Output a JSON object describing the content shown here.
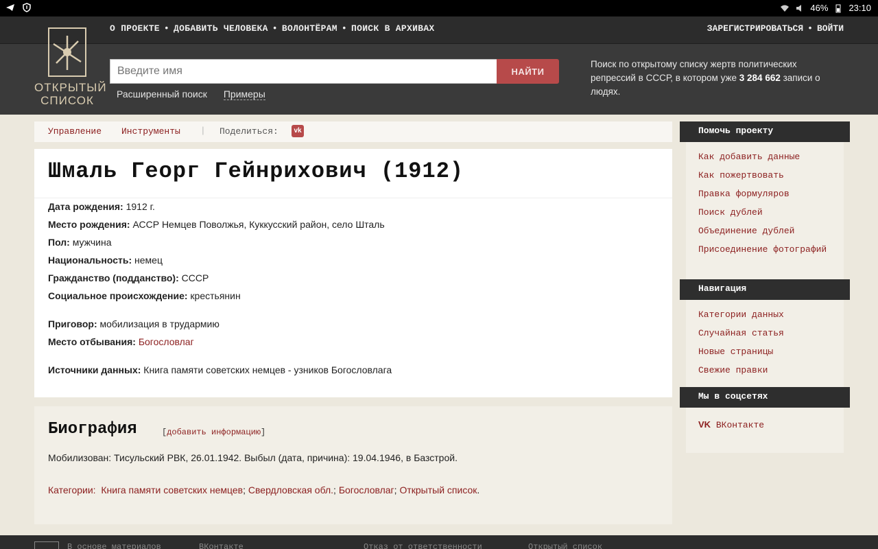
{
  "status_bar": {
    "battery": "46%",
    "time": "23:10",
    "icons": [
      "telegram-icon",
      "shield-icon",
      "wifi-icon",
      "mute-icon",
      "battery-icon"
    ]
  },
  "nav": {
    "left": [
      "О ПРОЕКТЕ",
      "ДОБАВИТЬ ЧЕЛОВЕКА",
      "ВОЛОНТЁРАМ",
      "ПОИСК В АРХИВАХ"
    ],
    "right": [
      "ЗАРЕГИСТРИРОВАТЬСЯ",
      "ВОЙТИ"
    ],
    "separator": "•"
  },
  "logo": {
    "line1": "ОТКРЫТЫЙ",
    "line2": "СПИСОК"
  },
  "search": {
    "placeholder": "Введите имя",
    "button": "НАЙТИ",
    "advanced": "Расширенный поиск",
    "examples": "Примеры"
  },
  "header_info": {
    "text_before": "Поиск по открытому списку жертв политических репрессий в СССР, в котором уже ",
    "count": "3 284 662",
    "text_after": " записи о людях."
  },
  "toolbar": {
    "manage": "Управление",
    "tools": "Инструменты",
    "separator": "|",
    "share": "Поделиться:",
    "vk": "vk"
  },
  "person": {
    "title": "Шмаль Георг Гейнрихович (1912)",
    "fields": [
      {
        "label": "Дата рождения:",
        "value": "1912 г."
      },
      {
        "label": "Место рождения:",
        "value": "АССР Немцев Поволжья, Куккусский район, село Шталь"
      },
      {
        "label": "Пол:",
        "value": "мужчина"
      },
      {
        "label": "Национальность:",
        "value": "немец"
      },
      {
        "label": "Гражданство (подданство):",
        "value": "СССР"
      },
      {
        "label": "Социальное происхождение:",
        "value": "крестьянин"
      },
      {
        "label": "Приговор:",
        "value": "мобилизация в трудармию"
      },
      {
        "label": "Место отбывания:",
        "value": "Богословлаг"
      },
      {
        "label": "Источники данных:",
        "value": "Книга памяти советских немцев - узников Богословлага"
      }
    ]
  },
  "biography": {
    "title": "Биография",
    "add_open": "[",
    "add_link": "добавить информацию",
    "add_close": "]",
    "text": "Мобилизован: Тисульский РВК, 26.01.1942. Выбыл (дата, причина): 19.04.1946, в Базстрой.",
    "categories_label": "Категории:",
    "categories": [
      "Книга памяти советских немцев",
      "Свердловская обл.",
      "Богословлаг",
      "Открытый список"
    ],
    "cat_sep": ";",
    "cat_end": "."
  },
  "sidebar": {
    "help": {
      "title": "Помочь проекту",
      "items": [
        "Как добавить данные",
        "Как пожертвовать",
        "Правка формуляров",
        "Поиск дублей",
        "Объединение дублей",
        "Присоединение фотографий"
      ]
    },
    "navigation": {
      "title": "Навигация",
      "items": [
        "Категории данных",
        "Случайная статья",
        "Новые страницы",
        "Свежие правки"
      ]
    },
    "social": {
      "title": "Мы в соцсетях",
      "items": [
        "ВКонтакте"
      ]
    }
  },
  "footer": {
    "based_on": "В основе материалов",
    "vk": "ВКонтакте",
    "disclaimer": "Отказ от ответственности",
    "open_list": "Открытый список"
  },
  "colors": {
    "accent": "#8b1e1e",
    "button": "#b74a4a",
    "header_dark": "#3a3a3a",
    "background": "#ece8dd"
  }
}
